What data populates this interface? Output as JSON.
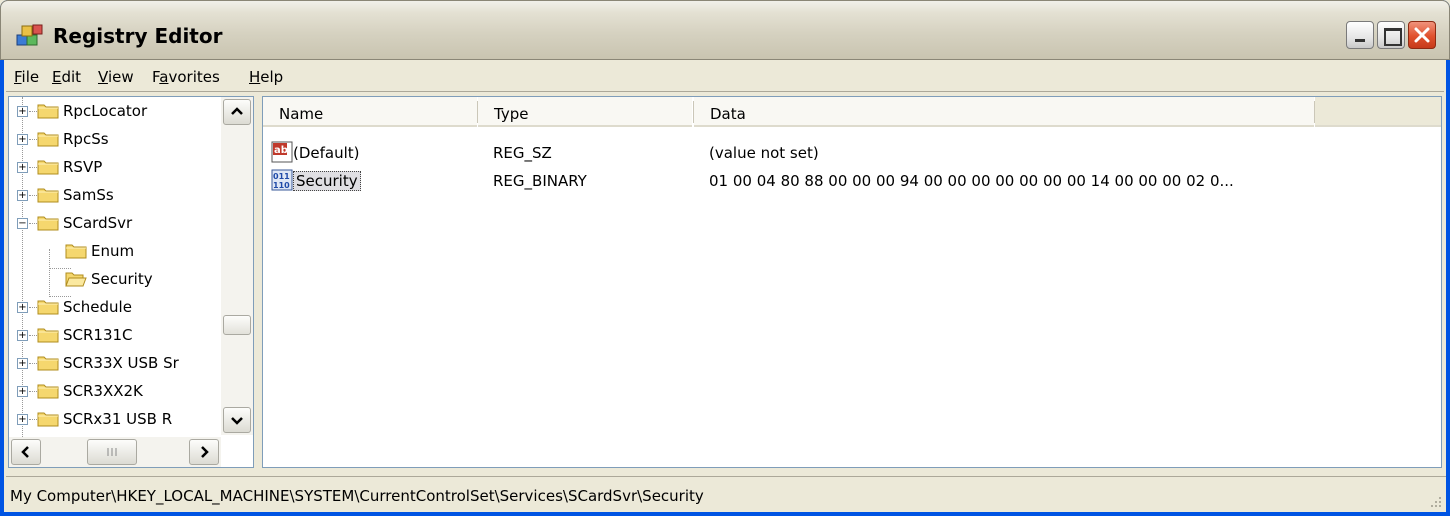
{
  "window": {
    "title": "Registry Editor"
  },
  "menu": [
    {
      "label": "File",
      "accel": "F",
      "rest": "ile"
    },
    {
      "label": "Edit",
      "accel": "E",
      "rest": "dit"
    },
    {
      "label": "View",
      "accel": "V",
      "rest": "iew"
    },
    {
      "label": "Favorites",
      "pre": "F",
      "accel": "a",
      "rest": "vorites"
    },
    {
      "label": "Help",
      "accel": "H",
      "rest": "elp"
    }
  ],
  "tree": [
    {
      "label": "RpcLocator",
      "expander": "+"
    },
    {
      "label": "RpcSs",
      "expander": "+"
    },
    {
      "label": "RSVP",
      "expander": "+"
    },
    {
      "label": "SamSs",
      "expander": "+"
    },
    {
      "label": "SCardSvr",
      "expander": "−"
    },
    {
      "label": "Enum",
      "expander": ""
    },
    {
      "label": "Security",
      "expander": "",
      "open": true
    },
    {
      "label": "Schedule",
      "expander": "+"
    },
    {
      "label": "SCR131C",
      "expander": "+"
    },
    {
      "label": "SCR33X USB Sr",
      "expander": "+"
    },
    {
      "label": "SCR3XX2K",
      "expander": "+"
    },
    {
      "label": "SCRx31 USB R",
      "expander": "+"
    }
  ],
  "list": {
    "columns": [
      "Name",
      "Type",
      "Data"
    ],
    "rows": [
      {
        "name": "(Default)",
        "type": "REG_SZ",
        "data": "(value not set)",
        "icon": "string-value-icon"
      },
      {
        "name": "Security",
        "type": "REG_BINARY",
        "data": "01 00 04 80 88 00 00 00 94 00 00 00 00 00 00 00 14 00 00 00 02 0...",
        "icon": "binary-value-icon",
        "selected": true
      }
    ]
  },
  "status": {
    "path": "My Computer\\HKEY_LOCAL_MACHINE\\SYSTEM\\CurrentControlSet\\Services\\SCardSvr\\Security"
  }
}
